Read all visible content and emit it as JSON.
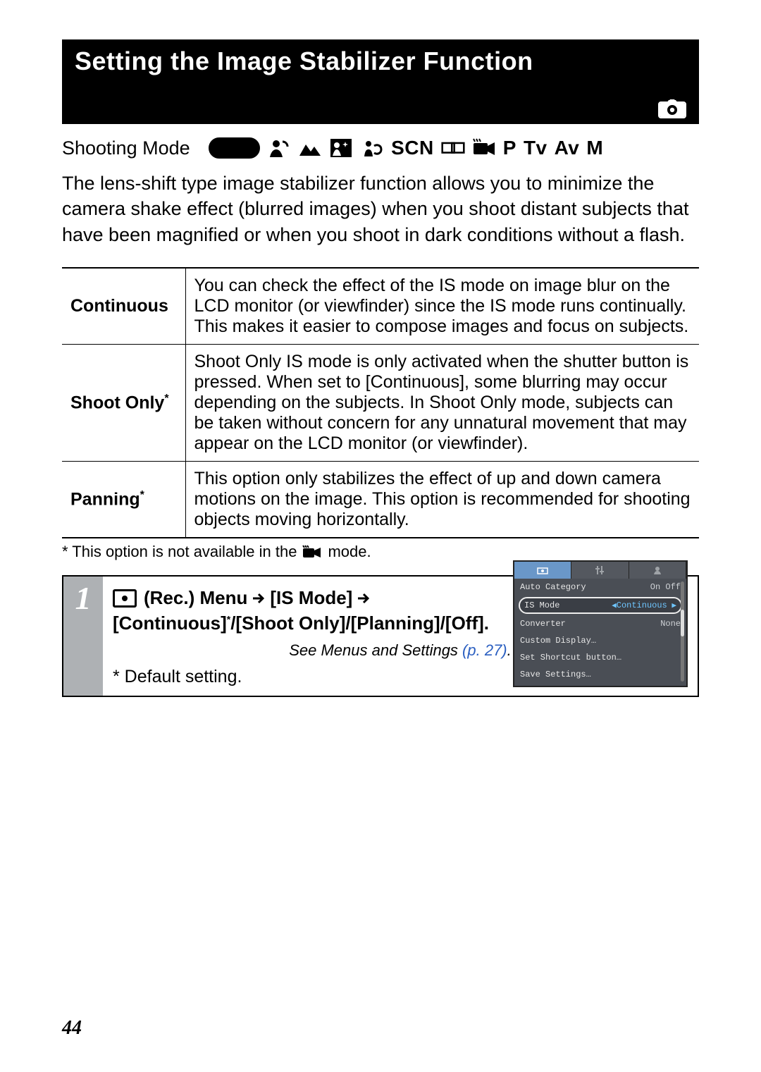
{
  "header": {
    "title": "Setting the Image Stabilizer Function"
  },
  "shooting_mode": {
    "label": "Shooting Mode",
    "auto": "AUTO",
    "scn": "SCN",
    "p": "P",
    "tv": "Tv",
    "av": "Av",
    "m": "M"
  },
  "intro": "The lens-shift type image stabilizer function allows you to minimize the camera shake effect (blurred images) when you shoot distant subjects that have been magnified or when you shoot in dark conditions without a flash.",
  "table": {
    "rows": [
      {
        "label": "Continuous",
        "asterisk": false,
        "desc": "You can check the effect of the IS mode on image blur on the LCD monitor (or viewfinder) since the IS mode runs continually. This makes it easier to compose images and focus on subjects."
      },
      {
        "label": "Shoot Only",
        "asterisk": true,
        "desc": "Shoot Only IS mode is only activated when the shutter button is pressed. When set to [Continuous], some blurring may occur depending on the subjects. In Shoot Only mode, subjects can be taken without concern for any unnatural movement that may appear on the LCD monitor (or viewfinder)."
      },
      {
        "label": "Panning",
        "asterisk": true,
        "desc": "This option only stabilizes the effect of up and down camera motions on the image. This option is recommended for shooting objects moving horizontally."
      }
    ]
  },
  "footnote": {
    "prefix": "* This option is not available in the ",
    "suffix": " mode."
  },
  "step": {
    "num": "1",
    "rec_label": "(Rec.) Menu",
    "is_mode_label": "[IS Mode]",
    "options_line": "[Continuous]*/[Shoot Only]/[Planning]/[Off].",
    "see_prefix": "See Menus and Settings ",
    "see_page": "(p. 27)",
    "see_suffix": ".",
    "default_setting": "* Default setting."
  },
  "lcd": {
    "rows": [
      {
        "label": "Auto Category",
        "value": "On Off"
      },
      {
        "label": "IS Mode",
        "value": "Continuous",
        "highlight": true
      },
      {
        "label": "Converter",
        "value": "None"
      },
      {
        "label": "Custom Display…",
        "value": ""
      },
      {
        "label": "Set Shortcut button…",
        "value": ""
      },
      {
        "label": "Save Settings…",
        "value": ""
      }
    ]
  },
  "page_number": "44"
}
